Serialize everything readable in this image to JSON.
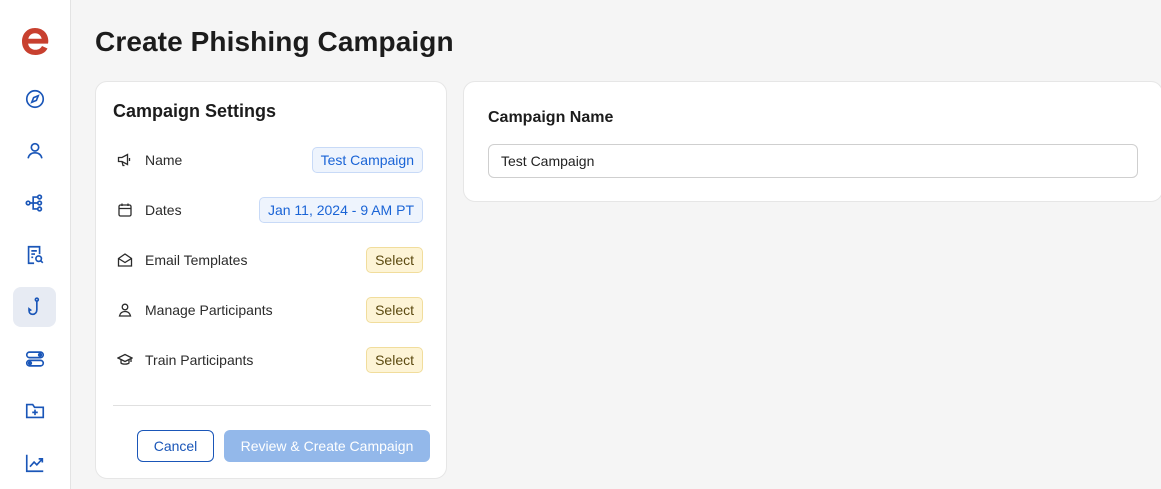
{
  "page": {
    "title": "Create Phishing Campaign"
  },
  "sidebar": {
    "logo": "e",
    "items": [
      {
        "icon": "compass-icon",
        "active": false
      },
      {
        "icon": "user-icon",
        "active": false
      },
      {
        "icon": "workflow-icon",
        "active": false
      },
      {
        "icon": "document-search-icon",
        "active": false
      },
      {
        "icon": "phishing-hook-icon",
        "active": true
      },
      {
        "icon": "toggles-icon",
        "active": false
      },
      {
        "icon": "folder-plus-icon",
        "active": false
      },
      {
        "icon": "trend-chart-icon",
        "active": false
      }
    ]
  },
  "settings": {
    "title": "Campaign Settings",
    "rows": [
      {
        "icon": "megaphone-icon",
        "label": "Name",
        "value": "Test Campaign",
        "style": "blue"
      },
      {
        "icon": "calendar-icon",
        "label": "Dates",
        "value": "Jan 11, 2024 - 9 AM PT",
        "style": "blue"
      },
      {
        "icon": "envelope-open-icon",
        "label": "Email Templates",
        "value": "Select",
        "style": "yellow"
      },
      {
        "icon": "user-icon",
        "label": "Manage Participants",
        "value": "Select",
        "style": "yellow"
      },
      {
        "icon": "graduation-cap-icon",
        "label": "Train Participants",
        "value": "Select",
        "style": "yellow"
      }
    ],
    "cancel_label": "Cancel",
    "review_label": "Review & Create Campaign"
  },
  "campaign_name": {
    "label": "Campaign Name",
    "value": "Test Campaign"
  },
  "colors": {
    "brand": "#c8402f",
    "accent": "#1a56b8",
    "pill_blue_text": "#1a64d6",
    "pill_yellow_bg": "#fdf4d6"
  }
}
